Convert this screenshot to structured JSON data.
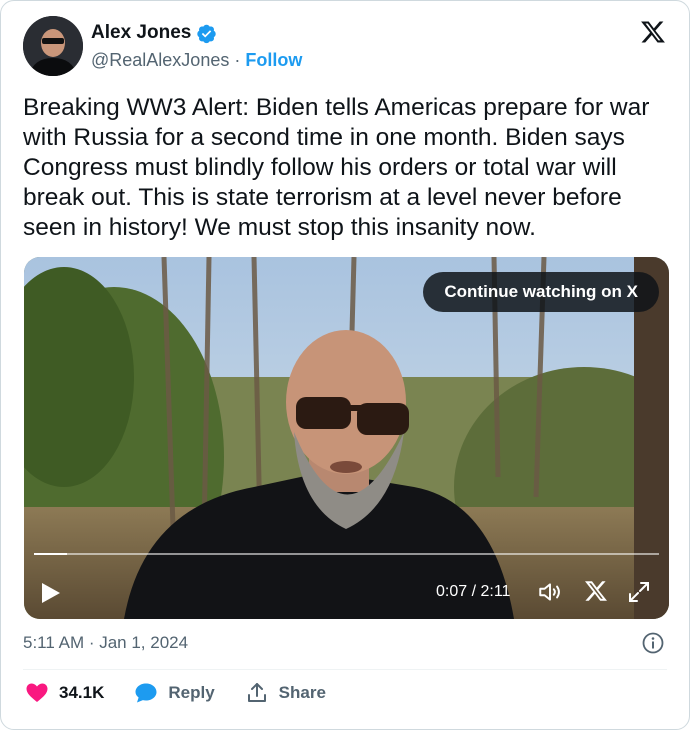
{
  "author": {
    "name": "Alex Jones",
    "handle": "@RealAlexJones",
    "separator": "·",
    "follow_label": "Follow"
  },
  "icons": {
    "verified": "verified-badge-icon",
    "platform": "x-logo-icon",
    "play": "play-icon",
    "volume": "volume-icon",
    "fullscreen": "fullscreen-icon",
    "info": "info-icon",
    "like": "heart-icon",
    "reply": "reply-bubble-icon",
    "share": "share-icon"
  },
  "tweet": {
    "text": "Breaking WW3 Alert: Biden tells Americas prepare for war with Russia for a second time in one month. Biden says Congress must blindly follow his orders or total war will break out. This is state terrorism at a level never before seen in history! We must stop this insanity now.",
    "timestamp": "5:11 AM · Jan 1, 2024"
  },
  "video": {
    "continue_label": "Continue watching on X",
    "time_display": "0:07 / 2:11",
    "progress_fraction": 0.053
  },
  "actions": {
    "likes": "34.1K",
    "reply_label": "Reply",
    "share_label": "Share"
  },
  "colors": {
    "accent": "#1d9bf0",
    "like": "#f91880",
    "text": "#0f1419",
    "muted": "#536471"
  }
}
